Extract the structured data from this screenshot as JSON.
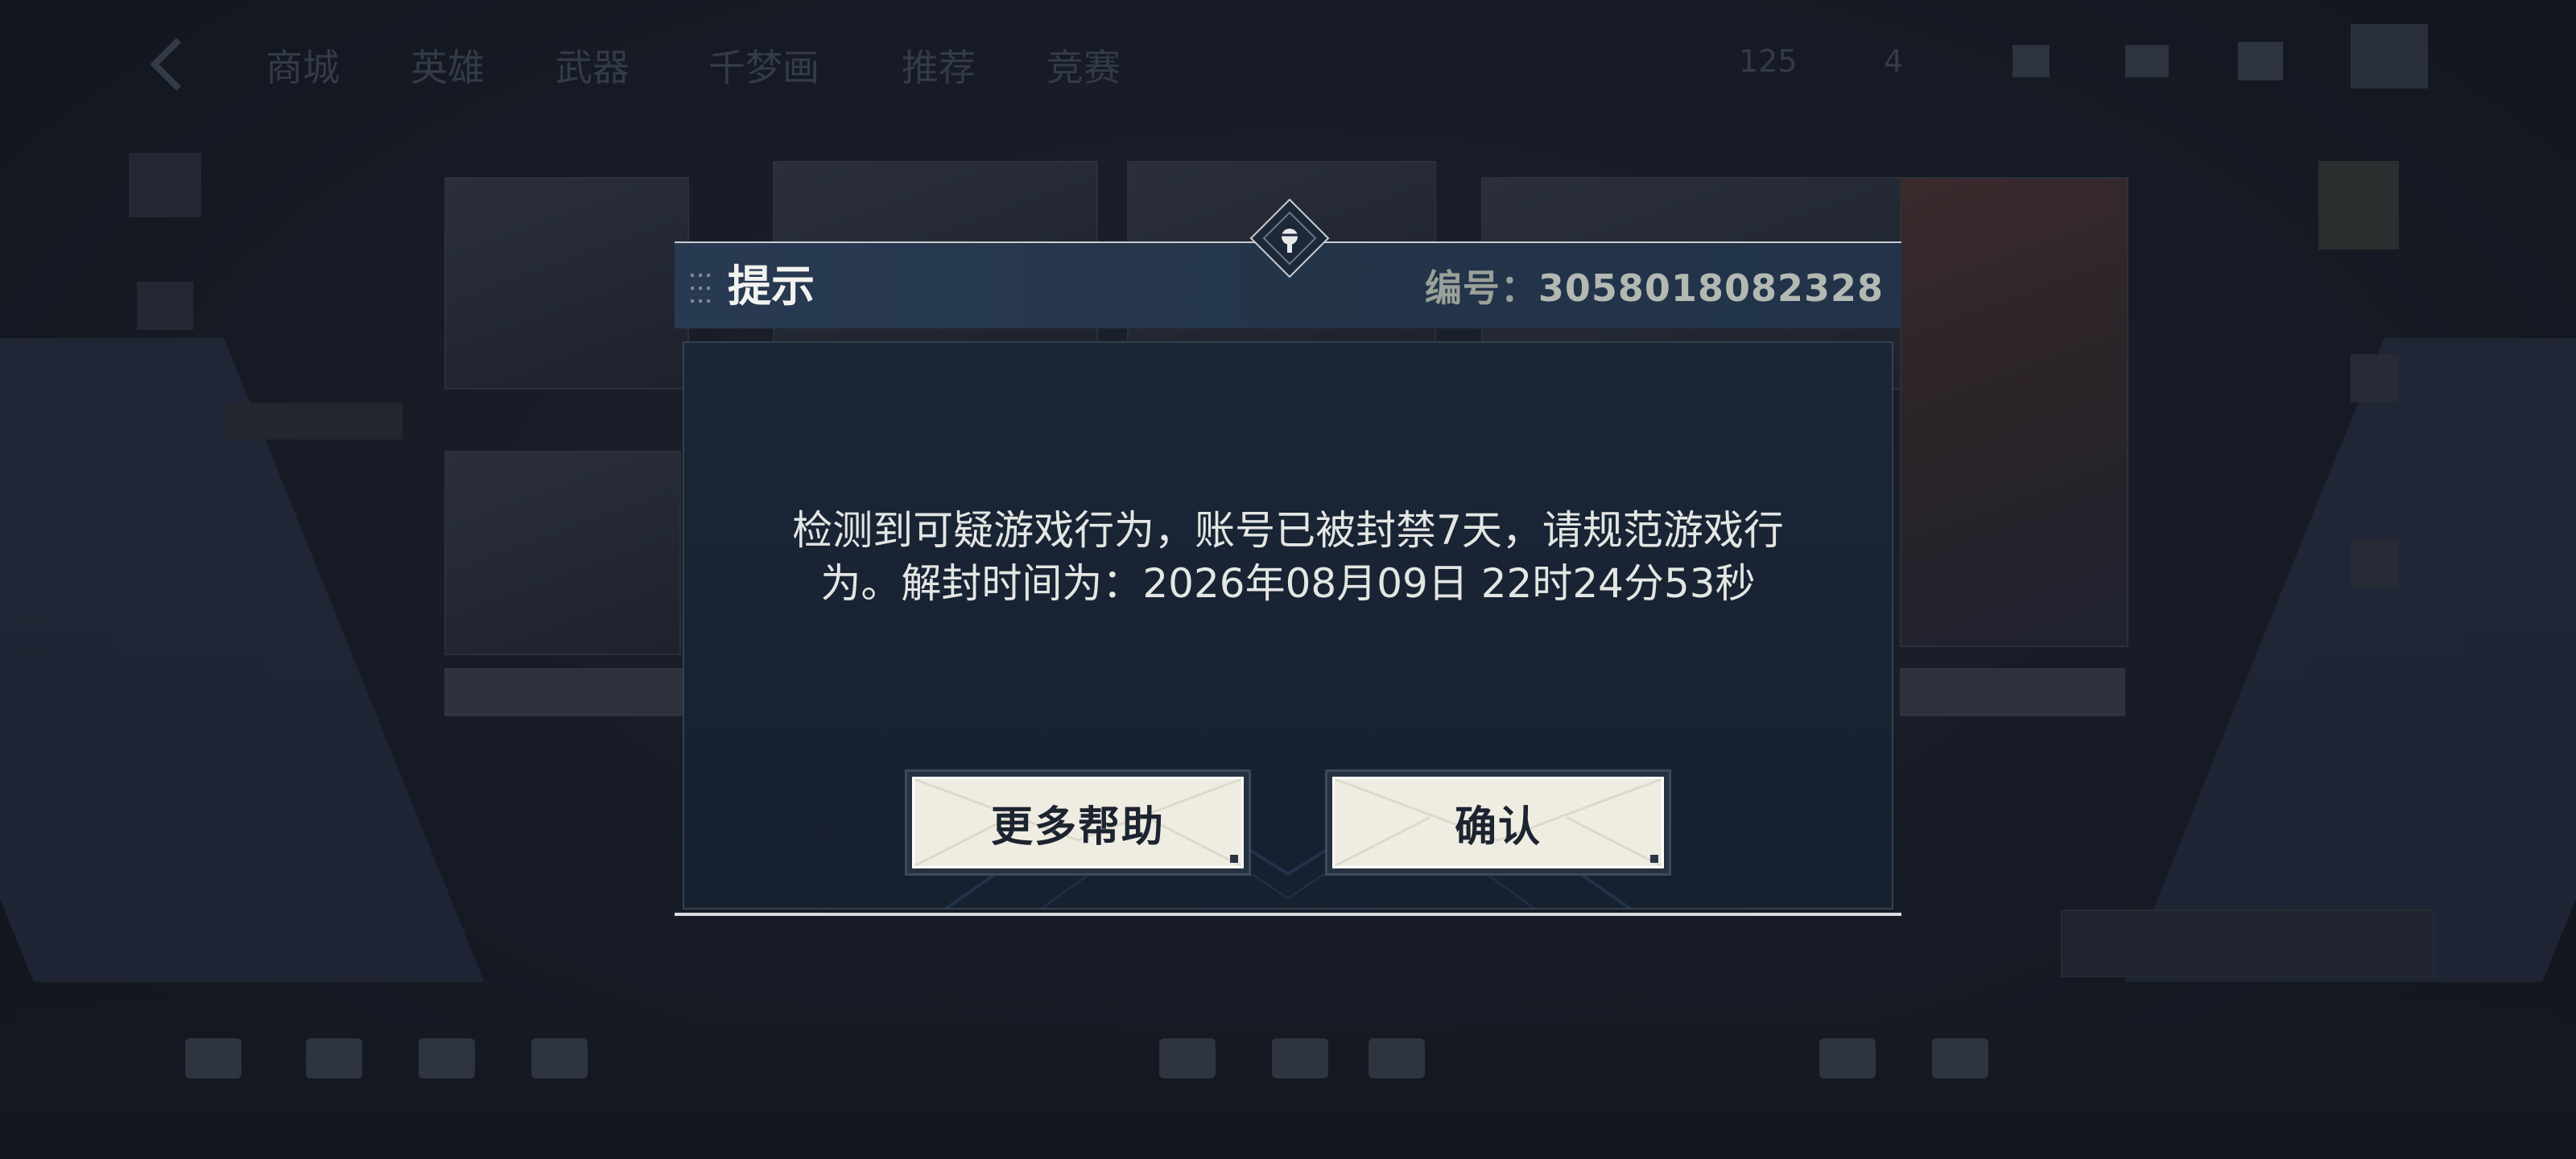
{
  "background": {
    "nav_tabs": [
      "商城",
      "英雄",
      "武器",
      "千梦画",
      "推荐",
      "竞赛"
    ],
    "status_items": [
      "125",
      "4",
      "",
      "",
      ""
    ],
    "bottom_items": [
      "",
      "",
      "",
      "",
      "",
      "",
      "",
      "",
      ""
    ]
  },
  "dialog": {
    "title": "提示",
    "code_label": "编号：",
    "code_value": "3058018082328",
    "message_line1": "检测到可疑游戏行为，账号已被封禁7天，请规范游戏行",
    "message_line2": "为。解封时间为：2026年08月09日 22时24分53秒",
    "buttons": {
      "help_label": "更多帮助",
      "confirm_label": "确认"
    }
  },
  "colors": {
    "header_bg": "#24354a",
    "body_bg": "#182232",
    "button_face": "#efece2",
    "title_text": "#f2f2ee",
    "code_text": "#b3b9b2"
  }
}
